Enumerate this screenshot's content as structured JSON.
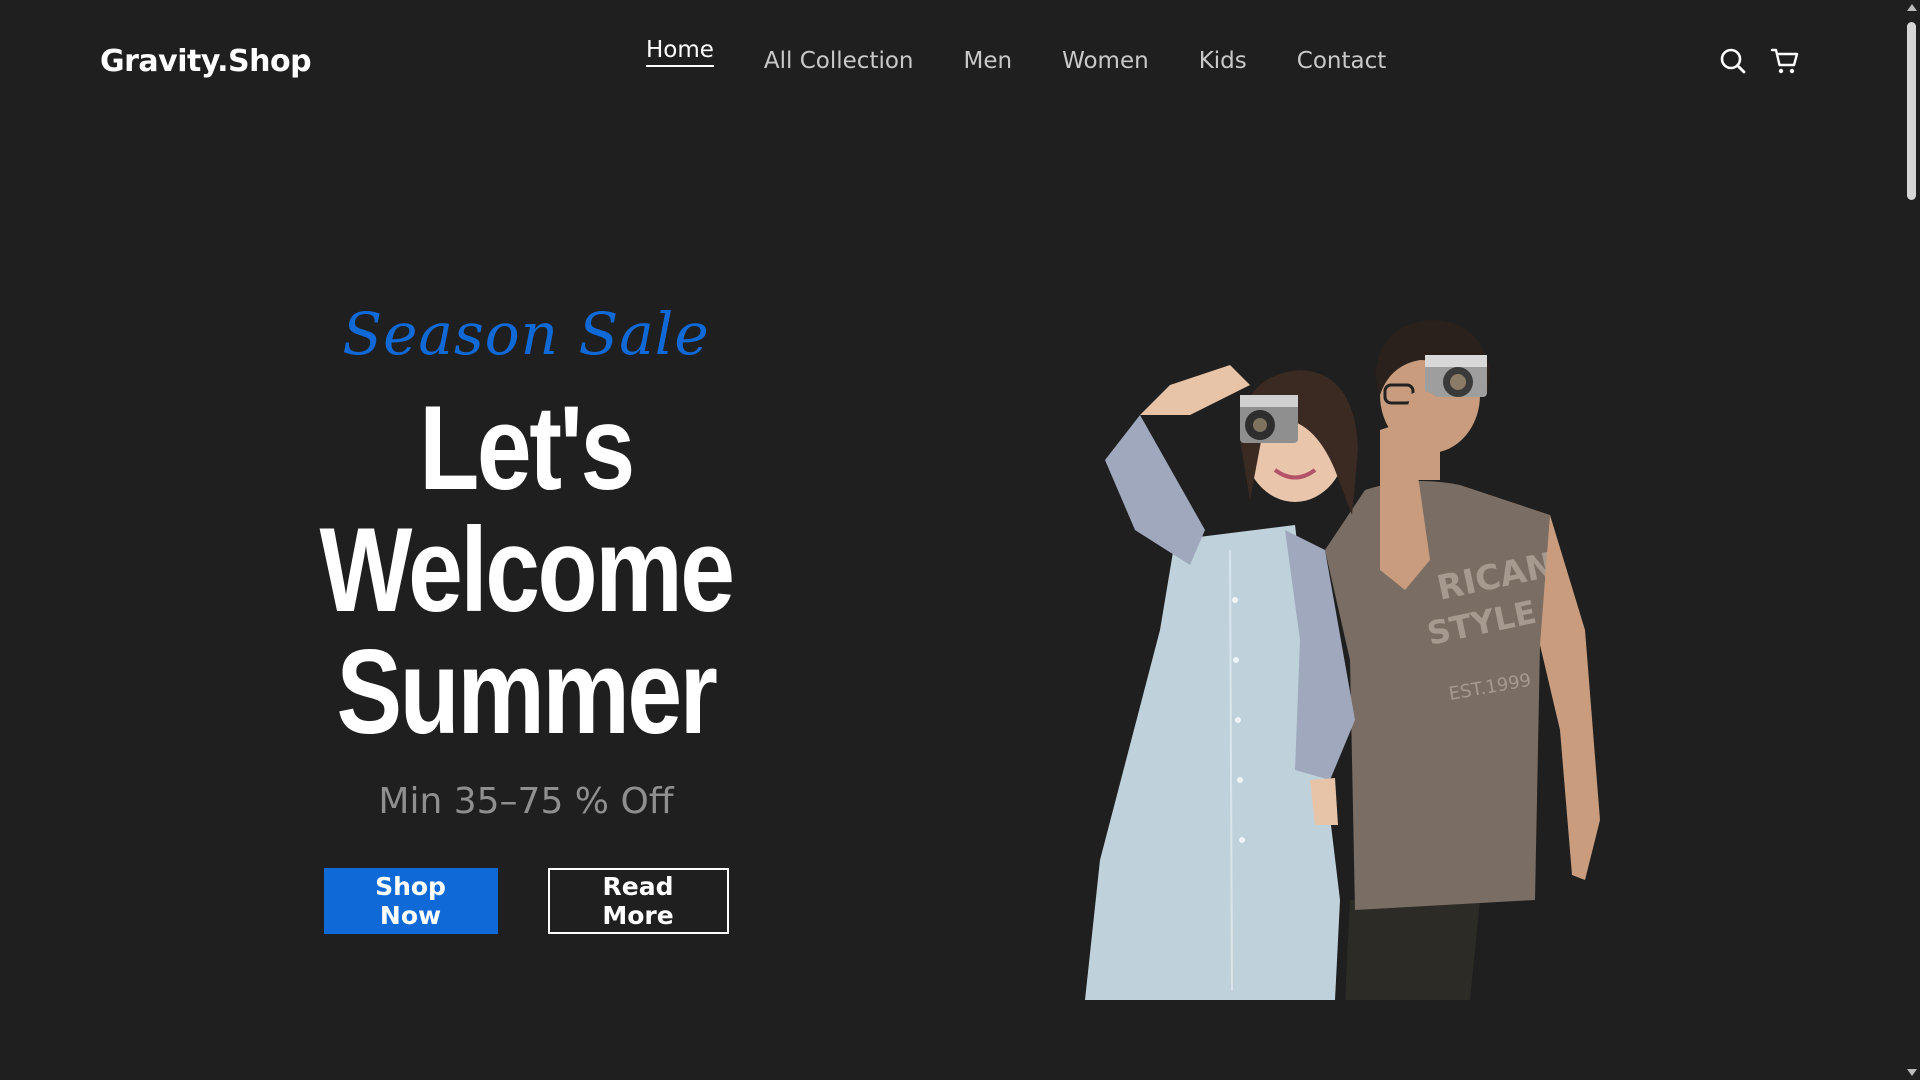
{
  "brand": {
    "logo": "Gravity.Shop"
  },
  "nav": {
    "items": [
      {
        "label": "Home",
        "active": true
      },
      {
        "label": "All Collection",
        "active": false
      },
      {
        "label": "Men",
        "active": false
      },
      {
        "label": "Women",
        "active": false
      },
      {
        "label": "Kids",
        "active": false
      },
      {
        "label": "Contact",
        "active": false
      }
    ]
  },
  "header": {
    "icons": [
      "search-icon",
      "cart-icon"
    ]
  },
  "hero": {
    "eyebrow": "Season Sale",
    "headline_line1": "Let's Welcome",
    "headline_line2": "Summer",
    "offer": "Min 35–75 % Off",
    "primary_button": "Shop Now",
    "secondary_button": "Read More"
  },
  "colors": {
    "background": "#1f1f1f",
    "accent": "#0f6ad8",
    "text": "#ffffff",
    "muted": "#8f8f8f"
  }
}
